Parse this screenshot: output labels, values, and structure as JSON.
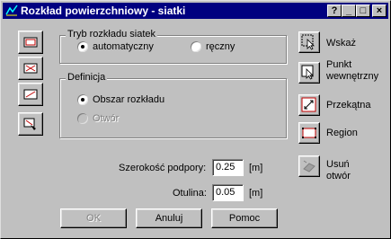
{
  "window": {
    "title": "Rozkład powierzchniowy - siatki"
  },
  "titlebar_buttons": [
    "?",
    "_",
    "□",
    "×"
  ],
  "groups": {
    "tryb": {
      "label": "Tryb rozkładu siatek",
      "options": [
        {
          "label": "automatyczny",
          "selected": true
        },
        {
          "label": "ręczny",
          "selected": false
        }
      ]
    },
    "definicja": {
      "label": "Definicja",
      "options": [
        {
          "label": "Obszar rozkładu",
          "selected": true
        },
        {
          "label": "Otwór",
          "selected": false,
          "disabled": true
        }
      ]
    }
  },
  "fields": {
    "szerokosc": {
      "label": "Szerokość podpory:",
      "value": "0.25",
      "unit": "[m]"
    },
    "otulina": {
      "label": "Otulina:",
      "value": "0.05",
      "unit": "[m]"
    }
  },
  "buttons": {
    "ok": "OK",
    "anuluj": "Anuluj",
    "pomoc": "Pomoc"
  },
  "right_tools": {
    "wskaz": "Wskaż",
    "punkt_line1": "Punkt",
    "punkt_line2": "wewnętrzny",
    "przekatna": "Przekątna",
    "region": "Region",
    "usun_line1": "Usuń",
    "usun_line2": "otwór"
  },
  "left_tools": [
    "mesh-rect-icon",
    "mesh-cross-icon",
    "mesh-diagonal-icon",
    "mesh-edit-icon"
  ]
}
